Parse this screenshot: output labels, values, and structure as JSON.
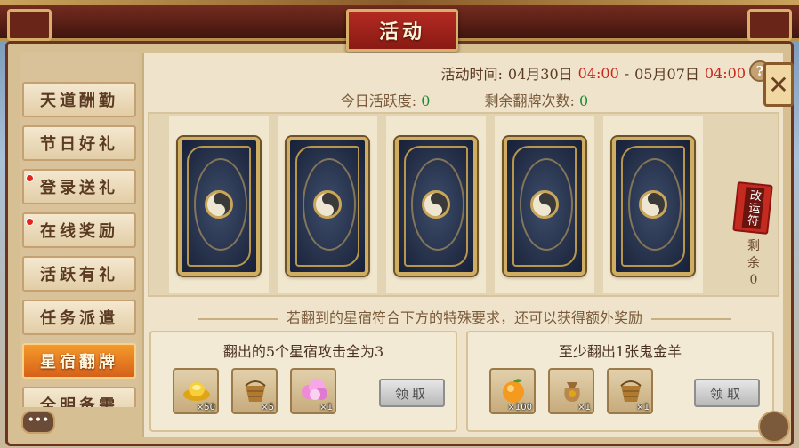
{
  "window": {
    "title": "活动"
  },
  "sidebar": {
    "items": [
      {
        "label": "天道酬勤",
        "red_dot": false,
        "active": false
      },
      {
        "label": "节日好礼",
        "red_dot": false,
        "active": false
      },
      {
        "label": "登录送礼",
        "red_dot": true,
        "active": false
      },
      {
        "label": "在线奖励",
        "red_dot": true,
        "active": false
      },
      {
        "label": "活跃有礼",
        "red_dot": false,
        "active": false
      },
      {
        "label": "任务派遣",
        "red_dot": false,
        "active": false
      },
      {
        "label": "星宿翻牌",
        "red_dot": false,
        "active": true
      },
      {
        "label": "全明备需",
        "red_dot": false,
        "active": false
      }
    ]
  },
  "header": {
    "time_label": "活动时间:",
    "start_date": "04月30日",
    "start_time": "04:00",
    "separator": "-",
    "end_date": "05月07日",
    "end_time": "04:00",
    "help": "?"
  },
  "stats": {
    "activity_label": "今日活跃度:",
    "activity_value": "0",
    "flips_label": "剩余翻牌次数:",
    "flips_value": "0"
  },
  "cards": [
    {
      "state": "face-down"
    },
    {
      "state": "face-down"
    },
    {
      "state": "face-down"
    },
    {
      "state": "face-down"
    },
    {
      "state": "face-down"
    }
  ],
  "fortune": {
    "tag_text": "改运符",
    "remain_label": "剩余",
    "remain_value": "0"
  },
  "hint": "若翻到的星宿符合下方的特殊要求，还可以获得额外奖励",
  "rewards": [
    {
      "title": "翻出的5个星宿攻击全为3",
      "items": [
        {
          "icon": "gold-ingot-icon",
          "count": "×50"
        },
        {
          "icon": "basket-icon",
          "count": "×5"
        },
        {
          "icon": "pink-cloud-icon",
          "count": "×1"
        }
      ],
      "button": "领取"
    },
    {
      "title": "至少翻出1张鬼金羊",
      "items": [
        {
          "icon": "orange-fruit-icon",
          "count": "×100"
        },
        {
          "icon": "money-bag-icon",
          "count": "×1"
        },
        {
          "icon": "basket-icon",
          "count": "×1"
        }
      ],
      "button": "领取"
    }
  ],
  "close": "✕",
  "chat": "•••"
}
